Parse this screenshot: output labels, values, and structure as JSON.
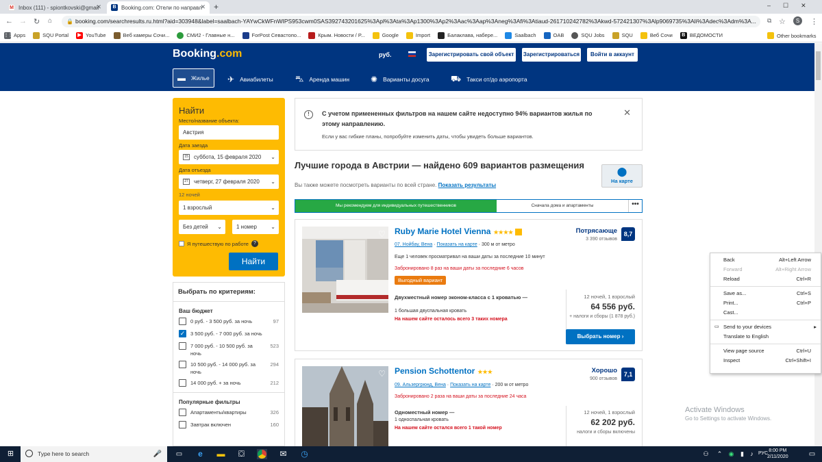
{
  "browser": {
    "tabs": [
      {
        "title": "Inbox (111) - spiontkovski@gmail.c...",
        "icon": "gmail-icon",
        "color": "#d93025"
      },
      {
        "title": "Booking.com: Отели по направле...",
        "icon": "booking-icon",
        "color": "#003580"
      }
    ],
    "url": "booking.com/searchresults.ru.html?aid=303948&label=saalbach-YAYwCkWFnWIPS953cwm0SAS392743201625%3Apl%3Ata%3Ap1300%3Ap2%3Aac%3Aap%3Aneg%3Afi%3Atiaud-261710242782%3Akwd-572421307%3Alp9069735%3Ali%3Adec%3Adm%3A...",
    "profile_initial": "S",
    "bookmarks": [
      {
        "label": "Apps",
        "color": "#5f6368"
      },
      {
        "label": "SQU Portal",
        "color": "#c9a227"
      },
      {
        "label": "YouTube",
        "color": "#ff0000"
      },
      {
        "label": "Веб камеры Сочи...",
        "color": "#7a5c2e"
      },
      {
        "label": "СМИ2 - Главные н...",
        "color": "#2c9b3c"
      },
      {
        "label": "ForPost Севастопо...",
        "color": "#1a3c8a"
      },
      {
        "label": "Крым. Новости / Р...",
        "color": "#b71c1c"
      },
      {
        "label": "Google",
        "color": "#f4c20d"
      },
      {
        "label": "Import",
        "color": "#f4c20d"
      },
      {
        "label": "Балаклава, набере...",
        "color": "#222222"
      },
      {
        "label": "Saalbach",
        "color": "#1e88e5"
      },
      {
        "label": "OAB",
        "color": "#1565c0"
      },
      {
        "label": "SQU Jobs",
        "color": "#555555"
      },
      {
        "label": "SQU",
        "color": "#c9a227"
      },
      {
        "label": "Веб Сочи",
        "color": "#f4c20d"
      },
      {
        "label": "ВЕДОМОСТИ",
        "color": "#111111"
      }
    ],
    "other_bookmarks": "Other bookmarks"
  },
  "header": {
    "logo": "Booking",
    "logo_suffix": ".com",
    "currency": "руб.",
    "register_property": "Зарегистрировать свой объект",
    "register": "Зарегистрироваться",
    "login": "Войти в аккаунт",
    "nav": [
      "Жилье",
      "Авиабилеты",
      "Аренда машин",
      "Варианты досуга",
      "Такси от/до аэропорта"
    ]
  },
  "search": {
    "title": "Найти",
    "dest_label": "Место/название объекта:",
    "dest_value": "Австрия",
    "checkin_label": "Дата заезда",
    "checkin_day": "15",
    "checkin_value": "суббота, 15 февраля 2020",
    "checkout_label": "Дата отъезда",
    "checkout_day": "27",
    "checkout_value": "четверг, 27 февраля 2020",
    "nights_label": "12 ночей",
    "adults": "1 взрослый",
    "children": "Без детей",
    "rooms": "1 номер",
    "work_trip": "Я путешествую по работе",
    "button": "Найти"
  },
  "filters": {
    "title": "Выбрать по критериям:",
    "budget_title": "Ваш бюджет",
    "budget": [
      {
        "label": "0 руб. - 3 500 руб. за ночь",
        "count": "97",
        "checked": false
      },
      {
        "label": "3 500 руб. - 7 000 руб. за ночь",
        "count": "",
        "checked": true
      },
      {
        "label": "7 000 руб. - 10 500 руб. за ночь",
        "count": "523",
        "checked": false
      },
      {
        "label": "10 500 руб. - 14 000 руб. за ночь",
        "count": "294",
        "checked": false
      },
      {
        "label": "14 000 руб. + за ночь",
        "count": "212",
        "checked": false
      }
    ],
    "popular_title": "Популярные фильтры",
    "popular": [
      {
        "label": "Апартаменты/квартиры",
        "count": "326"
      },
      {
        "label": "Завтрак включен",
        "count": "160"
      }
    ]
  },
  "alert": {
    "title": "С учетом примененных фильтров на нашем сайте недоступно 94% вариантов жилья по этому направлению.",
    "body": "Если у вас гибкие планы, попробуйте изменить даты, чтобы увидеть больше вариантов."
  },
  "results": {
    "title": "Лучшие города в Австрии — найдено 609 вариантов размещения",
    "subtitle": "Вы также можете посмотреть варианты по всей стране.",
    "subtitle_link": "Показать результаты",
    "map_label": "На карте",
    "sort_recommended": "Мы рекомендуем для индивидуальных путешественников",
    "sort_homes": "Сначала дома и апартаменты",
    "sort_more": "•••"
  },
  "hotels": [
    {
      "name": "Ruby Marie Hotel Vienna",
      "stars": "★★★★",
      "district": "07. Нойбау, Вена",
      "map_link": "Показать на карте",
      "distance": "300 м от метро",
      "viewing": "Еще 1 человек просматривал на ваши даты за последние 10 минут",
      "booked": "Забронировано 8 раз на ваши даты за последние 6 часов",
      "deal": "Выгодный вариант",
      "room": "Двухместный номер эконом-класса с 1 кроватью —",
      "bed": "1 большая двуспальная кровать",
      "left": "На нашем сайте осталось всего 3 таких номера",
      "review_word": "Потрясающе",
      "review_count": "3 390 отзывов",
      "score": "8,7",
      "nights": "12 ночей, 1 взрослый",
      "price": "64 556 руб.",
      "taxes": "+ налоги и сборы (1 878 руб.)",
      "button": "Выбрать номер"
    },
    {
      "name": "Pension Schottentor",
      "stars": "★★★",
      "district": "09. Альзергрюнд, Вена",
      "map_link": "Показать на карте",
      "distance": "200 м от метро",
      "booked": "Забронировано 2 раза на ваши даты за последние 24 часа",
      "room": "Одноместный номер —",
      "bed": "1 односпальная кровать",
      "left": "На нашем сайте остался всего 1 такой номер",
      "review_word": "Хорошо",
      "review_count": "900 отзывов",
      "score": "7,1",
      "nights": "12 ночей, 1 взрослый",
      "price": "62 202 руб.",
      "taxes": "налоги и сборы включены"
    }
  ],
  "context_menu": [
    {
      "label": "Back",
      "shortcut": "Alt+Left Arrow",
      "disabled": false
    },
    {
      "label": "Forward",
      "shortcut": "Alt+Right Arrow",
      "disabled": true
    },
    {
      "label": "Reload",
      "shortcut": "Ctrl+R",
      "disabled": false
    },
    {
      "sep": true
    },
    {
      "label": "Save as...",
      "shortcut": "Ctrl+S",
      "disabled": false
    },
    {
      "label": "Print...",
      "shortcut": "Ctrl+P",
      "disabled": false
    },
    {
      "label": "Cast...",
      "shortcut": "",
      "disabled": false
    },
    {
      "sep": true
    },
    {
      "label": "Send to your devices",
      "shortcut": "",
      "submenu": true,
      "disabled": false
    },
    {
      "label": "Translate to English",
      "shortcut": "",
      "disabled": false
    },
    {
      "sep": true
    },
    {
      "label": "View page source",
      "shortcut": "Ctrl+U",
      "disabled": false
    },
    {
      "label": "Inspect",
      "shortcut": "Ctrl+Shift+I",
      "disabled": false
    }
  ],
  "watermark": {
    "title": "Activate Windows",
    "body": "Go to Settings to activate Windows."
  },
  "taskbar": {
    "search_placeholder": "Type here to search",
    "lang": "РУС",
    "time": "8:00 PM",
    "date": "2/11/2020"
  }
}
